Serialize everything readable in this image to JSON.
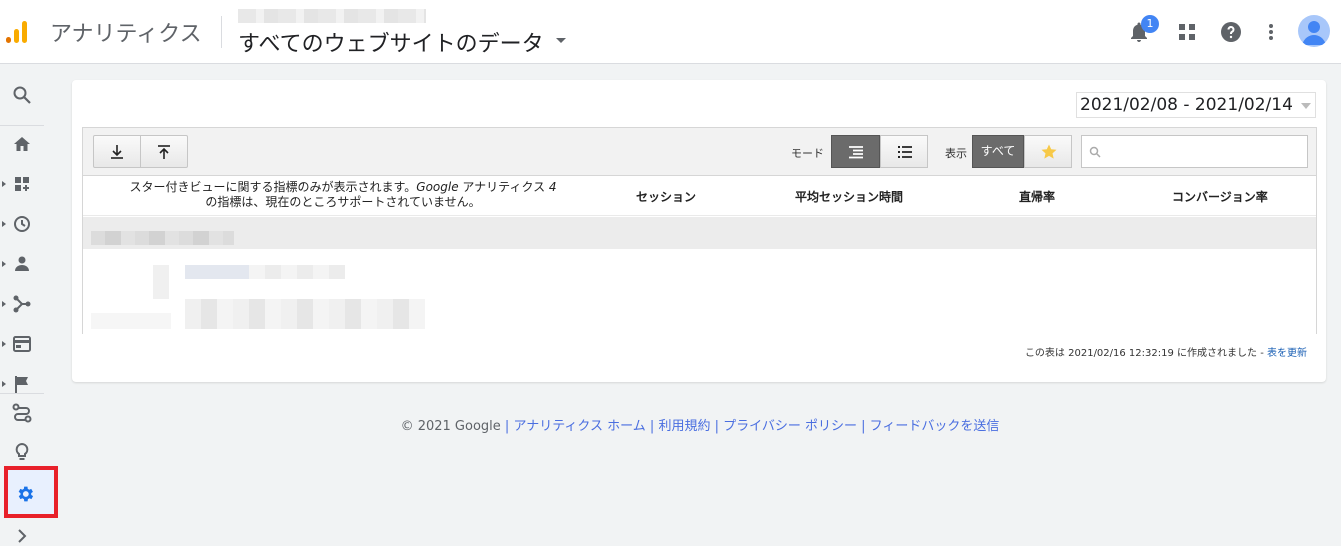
{
  "header": {
    "app_name": "アナリティクス",
    "property_title": "すべてのウェブサイトのデータ",
    "notification_count": "1",
    "logo_colors": [
      "#f9ab00",
      "#e37400"
    ]
  },
  "nav": {
    "items": [
      "search-icon",
      "home-icon",
      "customization-icon",
      "realtime-icon",
      "audience-icon",
      "acquisition-icon",
      "behavior-icon",
      "conversions-icon",
      "attribution-icon",
      "discover-icon",
      "admin-gear-icon",
      "expand-icon"
    ]
  },
  "report": {
    "date_range": "2021/02/08 - 2021/02/14",
    "toolbar": {
      "mode_label": "モード",
      "show_label": "表示",
      "show_all_label": "すべて",
      "search_placeholder": ""
    },
    "columns": {
      "note_line1": "スター付きビューに関する指標のみが表示されます。",
      "note_google": "Google",
      "note_line1b": " アナリティクス ",
      "note_four": "4",
      "note_line2": "の指標は、現在のところサポートされていません。",
      "sessions": "セッション",
      "avg_session": "平均セッション時間",
      "bounce_rate": "直帰率",
      "conversion_rate": "コンバージョン率"
    },
    "footnote_text": "この表は 2021/02/16 12:32:19 に作成されました - ",
    "footnote_link": "表を更新"
  },
  "footer": {
    "copyright": "© 2021 Google",
    "links": [
      "アナリティクス ホーム",
      "利用規約",
      "プライバシー ポリシー",
      "フィードバックを送信"
    ]
  },
  "colors": {
    "accent": "#4285f4",
    "admin_highlight": "#e8202a",
    "link": "#1a5fb4"
  }
}
